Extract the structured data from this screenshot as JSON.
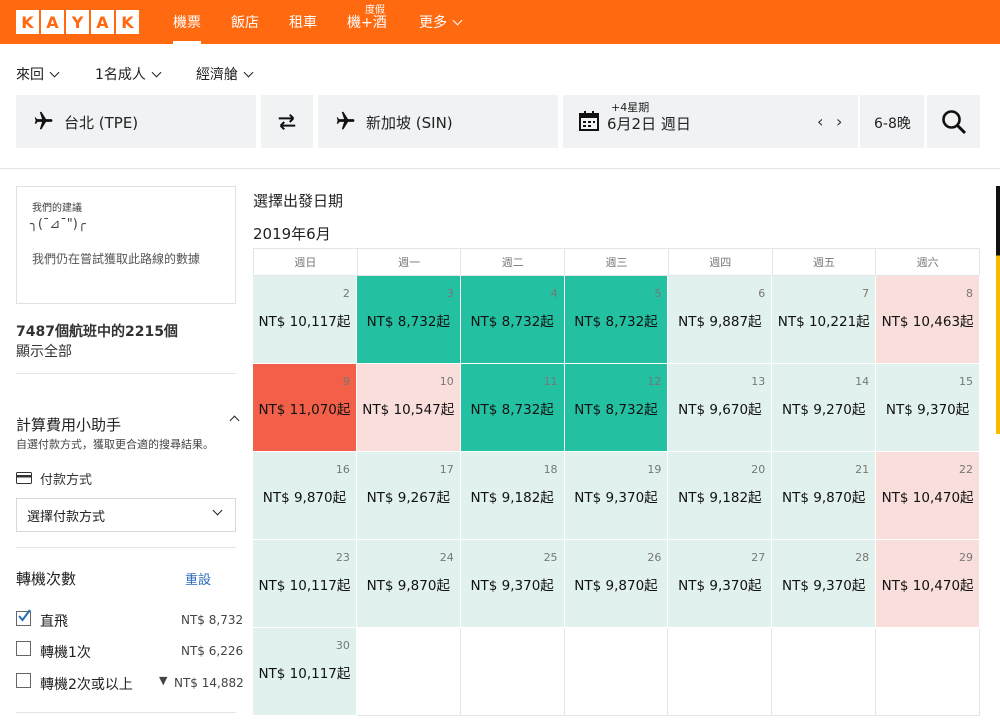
{
  "brand": {
    "logo_letters": [
      "K",
      "A",
      "Y",
      "A",
      "K"
    ],
    "accent": "#ff690f"
  },
  "nav": {
    "items": [
      {
        "label": "機票",
        "active": true
      },
      {
        "label": "飯店"
      },
      {
        "label": "租車"
      },
      {
        "label": "機+酒",
        "badge": "度假"
      },
      {
        "label": "更多"
      }
    ]
  },
  "search": {
    "trip_type": "來回",
    "passengers": "1名成人",
    "cabin": "經濟艙",
    "origin": "台北 (TPE)",
    "destination": "新加坡 (SIN)",
    "date_flex": "+4星期",
    "date": "6月2日 週日",
    "nights": "6-8晚"
  },
  "sidebar": {
    "tip_title": "我們的建議",
    "tip_face": "╮(¯⊿¯\")╭",
    "tip_text": "我們仍在嘗試獲取此路線的數據",
    "result_count": "7487個航班中的2215個",
    "show_all": "顯示全部",
    "fee_helper_title": "計算費用小助手",
    "fee_helper_desc": "自選付款方式，獲取更合適的搜尋結果。",
    "payment_label": "付款方式",
    "payment_select": "選擇付款方式",
    "stops_title": "轉機次數",
    "reset": "重設",
    "stops": [
      {
        "label": "直飛",
        "price": "NT$ 8,732",
        "checked": true
      },
      {
        "label": "轉機1次",
        "price": "NT$ 6,226",
        "checked": false
      },
      {
        "label": "轉機2次或以上",
        "price": "NT$ 14,882",
        "checked": false,
        "filter_icon": true
      }
    ]
  },
  "calendar": {
    "heading": "選擇出發日期",
    "month": "2019年6月",
    "weekdays": [
      "週日",
      "週一",
      "週二",
      "週三",
      "週四",
      "週五",
      "週六"
    ],
    "colors": {
      "teal": "#24c0a2",
      "light": "#e0f1ee",
      "pink": "#fadedb",
      "red": "#f2604a"
    },
    "days": [
      {
        "day": "2",
        "price": "NT$ 10,117起",
        "tone": "light"
      },
      {
        "day": "3",
        "price": "NT$ 8,732起",
        "tone": "teal"
      },
      {
        "day": "4",
        "price": "NT$ 8,732起",
        "tone": "teal"
      },
      {
        "day": "5",
        "price": "NT$ 8,732起",
        "tone": "teal"
      },
      {
        "day": "6",
        "price": "NT$ 9,887起",
        "tone": "light"
      },
      {
        "day": "7",
        "price": "NT$ 10,221起",
        "tone": "light"
      },
      {
        "day": "8",
        "price": "NT$ 10,463起",
        "tone": "pink"
      },
      {
        "day": "9",
        "price": "NT$ 11,070起",
        "tone": "red"
      },
      {
        "day": "10",
        "price": "NT$ 10,547起",
        "tone": "pink"
      },
      {
        "day": "11",
        "price": "NT$ 8,732起",
        "tone": "teal"
      },
      {
        "day": "12",
        "price": "NT$ 8,732起",
        "tone": "teal"
      },
      {
        "day": "13",
        "price": "NT$ 9,670起",
        "tone": "light"
      },
      {
        "day": "14",
        "price": "NT$ 9,270起",
        "tone": "light"
      },
      {
        "day": "15",
        "price": "NT$ 9,370起",
        "tone": "light"
      },
      {
        "day": "16",
        "price": "NT$ 9,870起",
        "tone": "light"
      },
      {
        "day": "17",
        "price": "NT$ 9,267起",
        "tone": "light"
      },
      {
        "day": "18",
        "price": "NT$ 9,182起",
        "tone": "light"
      },
      {
        "day": "19",
        "price": "NT$ 9,370起",
        "tone": "light"
      },
      {
        "day": "20",
        "price": "NT$ 9,182起",
        "tone": "light"
      },
      {
        "day": "21",
        "price": "NT$ 9,870起",
        "tone": "light"
      },
      {
        "day": "22",
        "price": "NT$ 10,470起",
        "tone": "pink"
      },
      {
        "day": "23",
        "price": "NT$ 10,117起",
        "tone": "light"
      },
      {
        "day": "24",
        "price": "NT$ 9,870起",
        "tone": "light"
      },
      {
        "day": "25",
        "price": "NT$ 9,370起",
        "tone": "light"
      },
      {
        "day": "26",
        "price": "NT$ 9,870起",
        "tone": "light"
      },
      {
        "day": "27",
        "price": "NT$ 9,370起",
        "tone": "light"
      },
      {
        "day": "28",
        "price": "NT$ 9,370起",
        "tone": "light"
      },
      {
        "day": "29",
        "price": "NT$ 10,470起",
        "tone": "pink"
      },
      {
        "day": "30",
        "price": "NT$ 10,117起",
        "tone": "light"
      },
      {
        "day": "",
        "price": "",
        "tone": "empty"
      },
      {
        "day": "",
        "price": "",
        "tone": "empty"
      },
      {
        "day": "",
        "price": "",
        "tone": "empty"
      },
      {
        "day": "",
        "price": "",
        "tone": "empty"
      },
      {
        "day": "",
        "price": "",
        "tone": "empty"
      },
      {
        "day": "",
        "price": "",
        "tone": "empty"
      }
    ]
  }
}
